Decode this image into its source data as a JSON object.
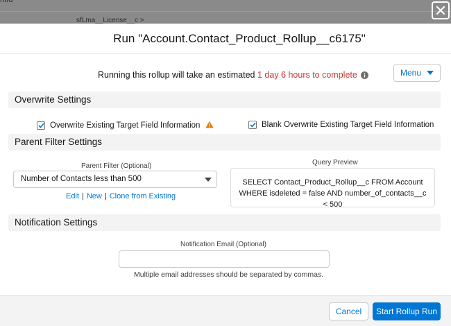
{
  "background": {
    "text_top": "ntId",
    "text_row": "sfLma__License__c >"
  },
  "modal": {
    "title": "Run \"Account.Contact_Product_Rollup__c6175\"",
    "estimate": {
      "prefix": "Running this rollup will take an estimated ",
      "highlight": "1 day 6 hours to complete",
      "highlight_color": "#c23934"
    },
    "menu_button": {
      "label": "Menu",
      "icon": "chevron-down-icon"
    }
  },
  "overwrite_settings": {
    "heading": "Overwrite Settings",
    "overwrite_existing": {
      "label": "Overwrite Existing Target Field Information",
      "checked": true,
      "icon": "warning-icon"
    },
    "blank_overwrite": {
      "label": "Blank Overwrite Existing Target Field Information",
      "checked": true
    }
  },
  "parent_filter_settings": {
    "heading": "Parent Filter Settings",
    "filter_label": "Parent Filter (Optional)",
    "filter_value": "Number of Contacts less than 500",
    "links": {
      "edit": "Edit",
      "new": "New",
      "clone": "Clone from Existing",
      "separator": "|"
    },
    "query_preview_label": "Query Preview",
    "query_preview_text": "SELECT Contact_Product_Rollup__c FROM Account WHERE isdeleted = false AND number_of_contacts__c < 500"
  },
  "notification_settings": {
    "heading": "Notification Settings",
    "email_label": "Notification Email (Optional)",
    "email_value": "",
    "email_help": "Multiple email addresses should be separated by commas."
  },
  "footer": {
    "cancel_label": "Cancel",
    "start_label": "Start Rollup Run"
  },
  "colors": {
    "brand_blue": "#0176d3",
    "warning_orange": "#dd7a01",
    "info_gray": "#706e6b"
  }
}
